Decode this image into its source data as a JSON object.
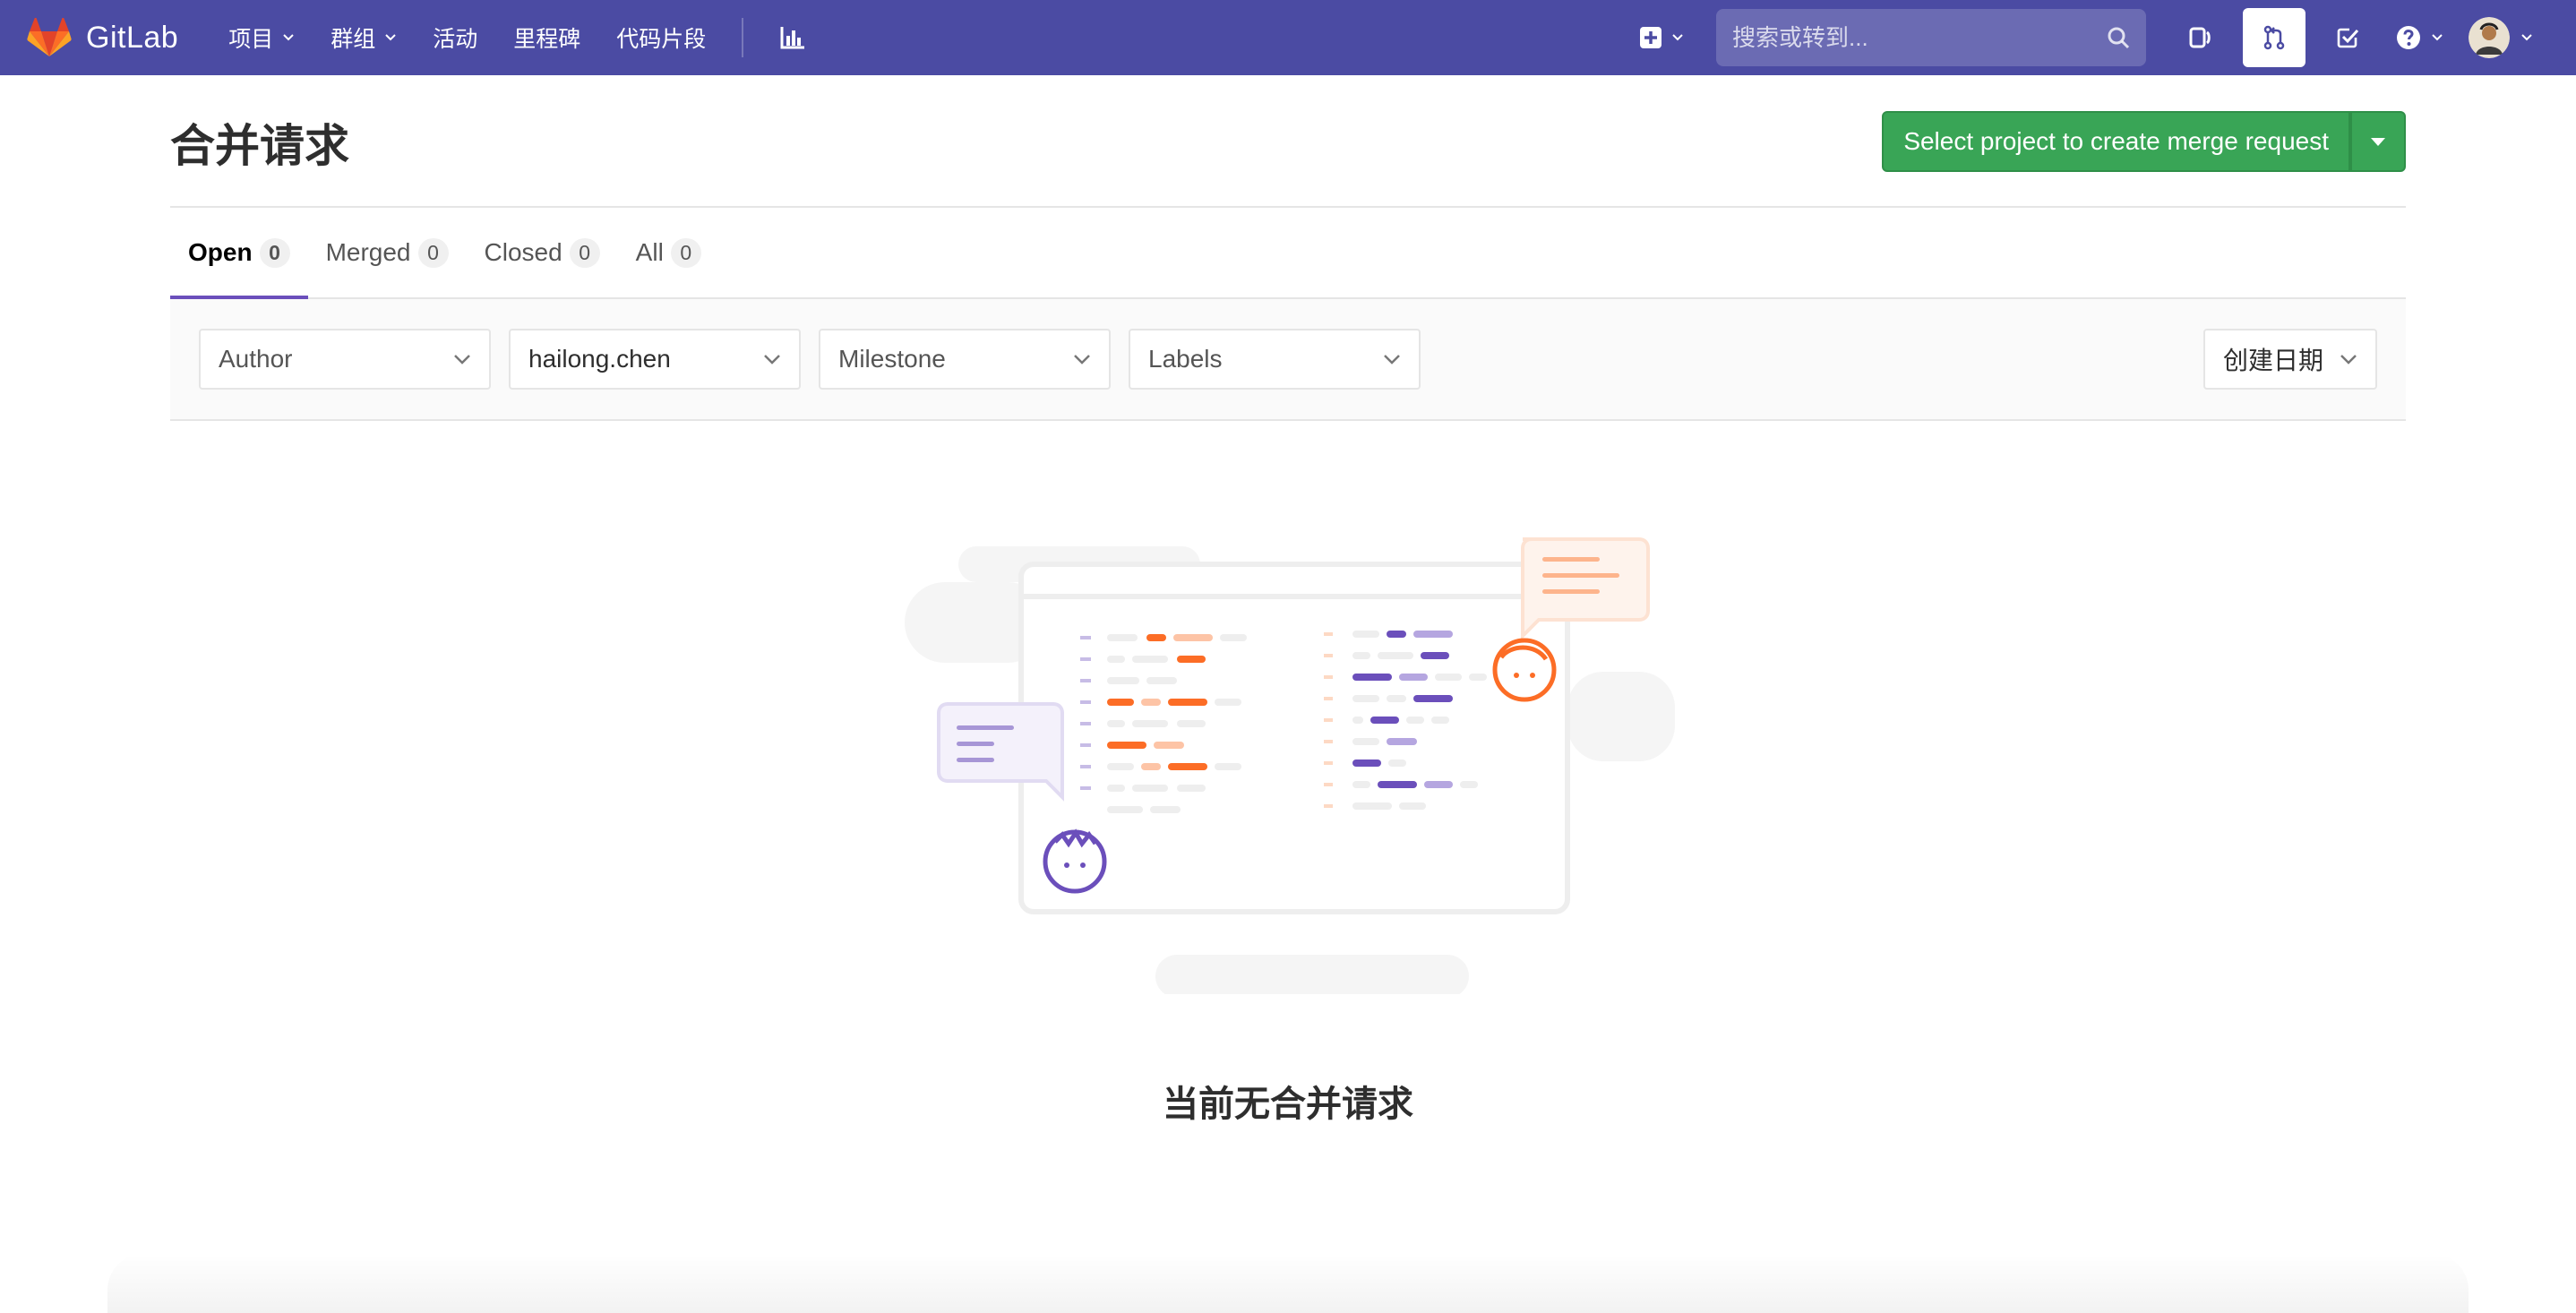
{
  "navbar": {
    "brand": "GitLab",
    "links": [
      {
        "label": "项目",
        "has_caret": true
      },
      {
        "label": "群组",
        "has_caret": true
      },
      {
        "label": "活动",
        "has_caret": false
      },
      {
        "label": "里程碑",
        "has_caret": false
      },
      {
        "label": "代码片段",
        "has_caret": false
      }
    ],
    "search_placeholder": "搜索或转到...",
    "icons": [
      "chart-icon",
      "plus-square-icon",
      "search-icon",
      "issues-icon",
      "merge-request-icon",
      "todo-icon",
      "help-icon",
      "avatar"
    ],
    "bg_color": "#4b4ba3"
  },
  "page": {
    "title": "合并请求",
    "create_button_label": "Select project to create merge request",
    "button_color": "#39a556"
  },
  "tabs": [
    {
      "label": "Open",
      "count": "0",
      "active": true
    },
    {
      "label": "Merged",
      "count": "0",
      "active": false
    },
    {
      "label": "Closed",
      "count": "0",
      "active": false
    },
    {
      "label": "All",
      "count": "0",
      "active": false
    }
  ],
  "filters": {
    "author": "Author",
    "assignee": "hailong.chen",
    "milestone": "Milestone",
    "labels": "Labels",
    "sort": "创建日期"
  },
  "empty_state": {
    "message": "当前无合并请求"
  }
}
